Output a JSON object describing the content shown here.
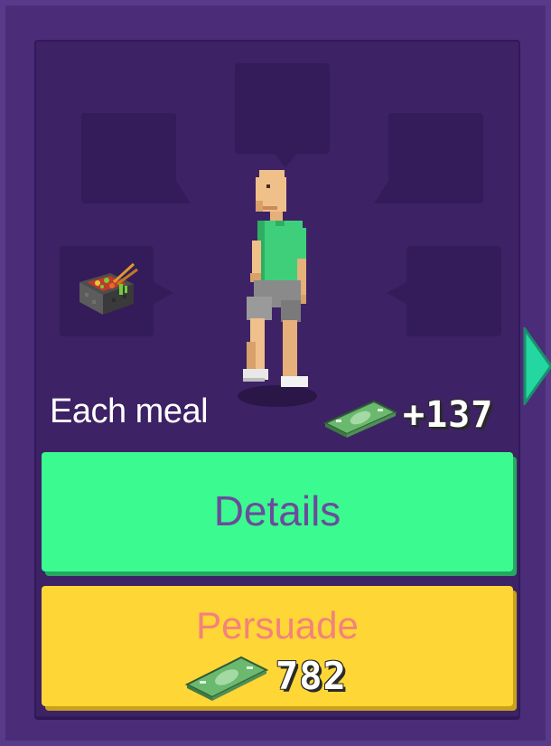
{
  "card": {
    "reward_label": "Each meal",
    "reward_value": "+137"
  },
  "buttons": {
    "details_label": "Details",
    "persuade_label": "Persuade",
    "persuade_cost": "782"
  },
  "icons": {
    "meal": "instant-noodle-cup-icon",
    "cash": "cash-bundle-icon",
    "next": "next-arrow-icon"
  },
  "colors": {
    "background": "#4a2c79",
    "card": "#3d2266",
    "bubble": "#331c59",
    "details_button": "#3bfa8f",
    "persuade_button": "#fed636",
    "persuade_text": "#f3827b",
    "details_text": "#6a4c9c",
    "arrow": "#24d6a0"
  }
}
